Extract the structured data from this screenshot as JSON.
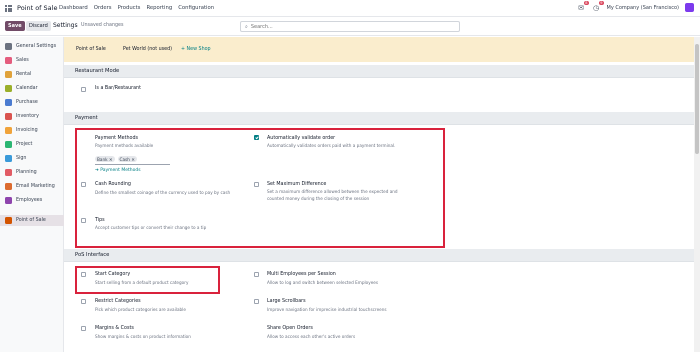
{
  "topbar": {
    "brand": "Point of Sale",
    "nav": [
      "Dashboard",
      "Orders",
      "Products",
      "Reporting",
      "Configuration"
    ],
    "chat_badge": "8",
    "activity_badge": "9",
    "company": "My Company (San Francisco)"
  },
  "controlbar": {
    "save_label": "Save",
    "discard_label": "Discard",
    "breadcrumb": "Settings",
    "unsaved": "Unsaved changes",
    "search_placeholder": "Search..."
  },
  "sidebar": {
    "items": [
      {
        "label": "General Settings",
        "color": "#6b7280"
      },
      {
        "label": "Sales",
        "color": "#e45c7d"
      },
      {
        "label": "Rental",
        "color": "#e0a23a"
      },
      {
        "label": "Calendar",
        "color": "#9aaf2a"
      },
      {
        "label": "Purchase",
        "color": "#4a7bd0"
      },
      {
        "label": "Inventory",
        "color": "#d9534f"
      },
      {
        "label": "Invoicing",
        "color": "#f0a33a"
      },
      {
        "label": "Project",
        "color": "#2bb673"
      },
      {
        "label": "Sign",
        "color": "#3a9ad9"
      },
      {
        "label": "Planning",
        "color": "#e15b64"
      },
      {
        "label": "Email Marketing",
        "color": "#dc6b2f"
      },
      {
        "label": "Employees",
        "color": "#8e44ad"
      },
      {
        "label": "Point of Sale",
        "color": "#d35400"
      }
    ]
  },
  "pos_bar": {
    "label": "Point of Sale",
    "shop": "Pet World (not used)",
    "new_shop": "+ New Shop"
  },
  "sections": {
    "restaurant": "Restaurant Mode",
    "payment": "Payment",
    "pos_interface": "PoS Interface"
  },
  "settings": {
    "bar_restaurant": {
      "title": "Is a Bar/Restaurant"
    },
    "payment_methods": {
      "title": "Payment Methods",
      "desc": "Payment methods available",
      "tags": [
        "Bank",
        "Cash"
      ],
      "link": "➔ Payment Methods"
    },
    "auto_validate": {
      "title": "Automatically validate order",
      "desc": "Automatically validates orders paid with a payment terminal."
    },
    "cash_rounding": {
      "title": "Cash Rounding",
      "desc": "Define the smallest coinage of the currency used to pay by cash"
    },
    "max_difference": {
      "title": "Set Maximum Difference",
      "desc1": "Set a maximum difference allowed between the expected and",
      "desc2": "counted money during the closing of the session"
    },
    "tips": {
      "title": "Tips",
      "desc": "Accept customer tips or convert their change to a tip"
    },
    "start_category": {
      "title": "Start Category",
      "desc": "Start selling from a default product category"
    },
    "multi_employees": {
      "title": "Multi Employees per Session",
      "desc": "Allow to log and switch between selected Employees"
    },
    "restrict_categories": {
      "title": "Restrict Categories",
      "desc": "Pick which product categories are available"
    },
    "large_scrollbars": {
      "title": "Large Scrollbars",
      "desc": "Improve navigation for imprecise industrial touchscreens"
    },
    "margins_costs": {
      "title": "Margins & Costs",
      "desc": "Show margins & costs on product information"
    },
    "share_orders": {
      "title": "Share Open Orders",
      "desc": "Allow to access each other's active orders"
    }
  },
  "colors": {
    "accent": "#714b67",
    "teal": "#017e84",
    "highlight": "#d9223c",
    "banner": "#faedcd"
  }
}
